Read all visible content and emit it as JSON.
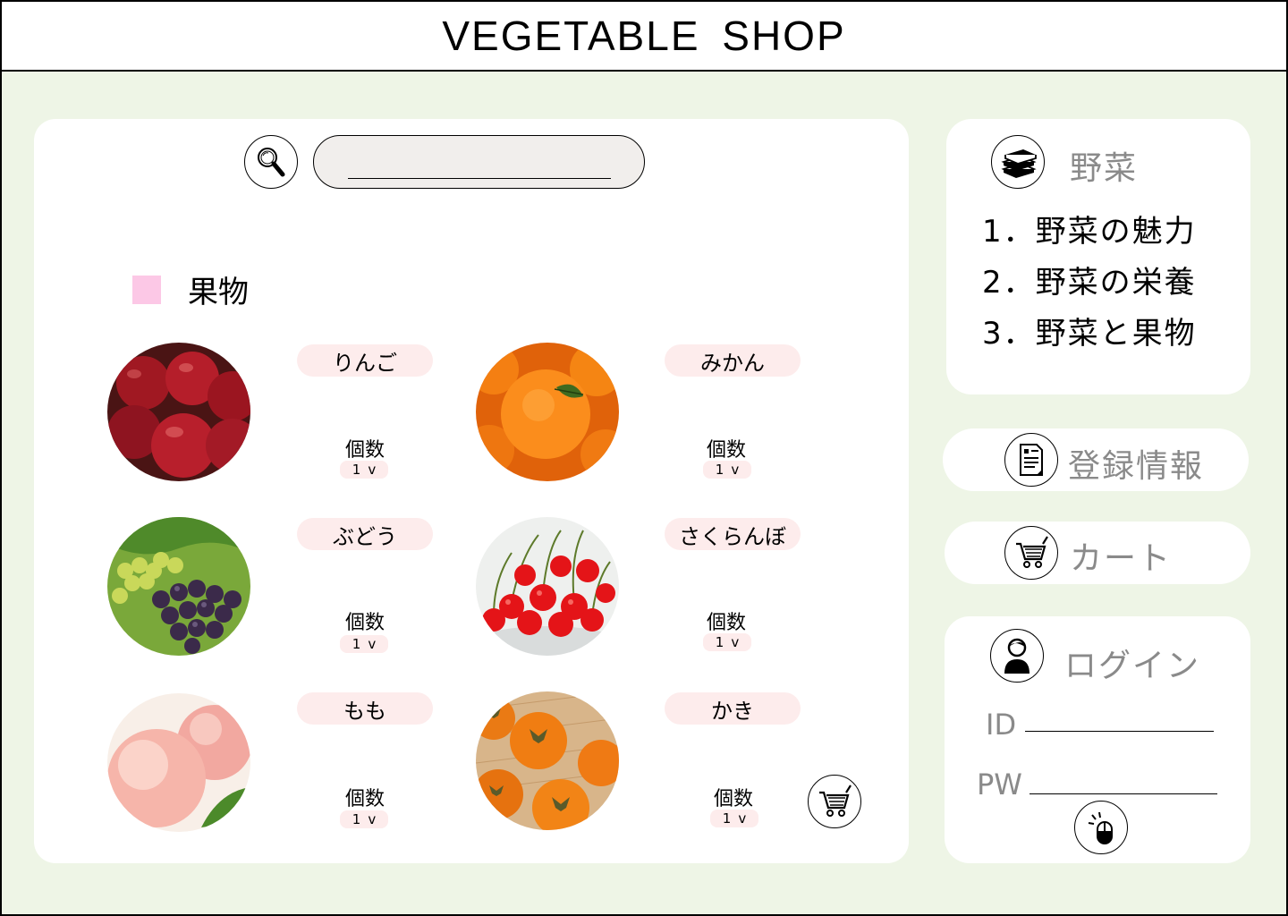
{
  "header": {
    "title": "VEGETABLE  SHOP"
  },
  "search": {
    "placeholder": "",
    "value": ""
  },
  "category": {
    "label": "果物",
    "swatch_color": "#fcc8e6"
  },
  "products": [
    {
      "name": "りんご",
      "qty_label": "個数",
      "qty": "1",
      "chevron": "v",
      "image": "apple-image"
    },
    {
      "name": "みかん",
      "qty_label": "個数",
      "qty": "1",
      "chevron": "v",
      "image": "mandarin-image"
    },
    {
      "name": "ぶどう",
      "qty_label": "個数",
      "qty": "1",
      "chevron": "v",
      "image": "grape-image"
    },
    {
      "name": "さくらんぼ",
      "qty_label": "個数",
      "qty": "1",
      "chevron": "v",
      "image": "cherry-image"
    },
    {
      "name": "もも",
      "qty_label": "個数",
      "qty": "1",
      "chevron": "v",
      "image": "peach-image"
    },
    {
      "name": "かき",
      "qty_label": "個数",
      "qty": "1",
      "chevron": "v",
      "image": "persimmon-image"
    }
  ],
  "sidebar": {
    "vegetables": {
      "title": "野菜",
      "icon": "books-icon",
      "items": [
        "1．野菜の魅力",
        "2．野菜の栄養",
        "3．野菜と果物"
      ]
    },
    "registration": {
      "label": "登録情報",
      "icon": "document-icon"
    },
    "cart": {
      "label": "カート",
      "icon": "cart-icon"
    },
    "login": {
      "title": "ログイン",
      "icon": "user-icon",
      "id_label": "ID",
      "pw_label": "PW",
      "submit_icon": "mouse-click-icon"
    }
  },
  "colors": {
    "background": "#eef5e6",
    "pill": "#fdecec",
    "search_box": "#f1eeec",
    "muted_text": "#8a8a8a"
  }
}
